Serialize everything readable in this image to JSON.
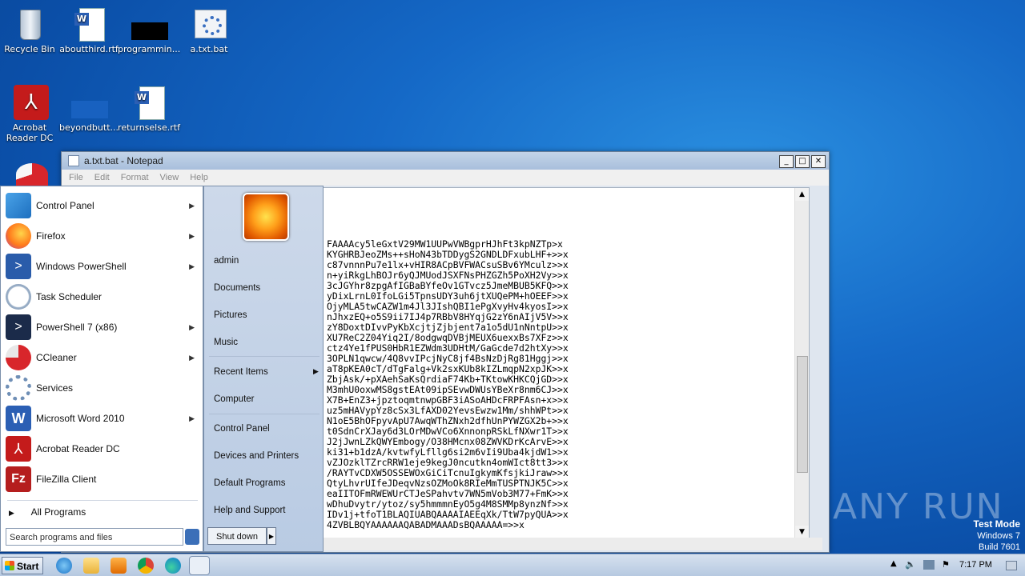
{
  "desktop": {
    "icons": [
      {
        "label": "Recycle Bin"
      },
      {
        "label": "aboutthird.rtf"
      },
      {
        "label": "programmin..."
      },
      {
        "label": "a.txt.bat"
      },
      {
        "label": "Acrobat Reader DC"
      },
      {
        "label": "beyondbutt..."
      },
      {
        "label": "returnselse.rtf"
      }
    ],
    "watermark": "ANY RUN",
    "testmode": {
      "line1": "Test Mode",
      "line2": "Windows 7",
      "line3": "Build 7601"
    }
  },
  "notepad": {
    "title": "a.txt.bat - Notepad",
    "menu": [
      "File",
      "Edit",
      "Format",
      "View",
      "Help"
    ],
    "controls": {
      "minimize": "_",
      "maximize": "□",
      "close": "✕"
    },
    "lines": [
      "FAAAAcy5leGxtV29MW1UUPwVWBgprHJhFt3kpNZTp>x",
      "KYGHRBJeoZMs++sHoN43bTDDygS2GNDLDFxubLHF+>>x",
      "c87vnnnPu7e1lx+vHIR8ACpBVFWACsuSBv6YMculz>>x",
      "n+yiRkgLhBOJr6yQJMUodJSXFNsPHZGZh5PoXH2Vy>>x",
      "3cJGYhr8zpgAfIGBaBYfeOv1GTvcz5JmeMBUB5KFQ>>x",
      "yDixLrnL0IfoLGi5TpnsUDY3uh6jtXUQePM+hOEEF>>x",
      "OjyMLA5twCAZW1m4Jl3JIshQBI1ePgXvyHv4kyosI>>x",
      "nJhxzEQ+o5S9ii7IJ4p7RBbV8HYqjG2zY6nAIjV5V>>x",
      "zY8DoxtDIvvPyKbXcjtjZjbjent7a1o5dU1nNntpU>>x",
      "XU7ReC2Z04Yiq2I/8odgwqDVBjMEUX6uexxBs7XFz>>x",
      "ctz4Ye1fPUS0HbR1EZWdm3UDHtM/GaGcde7d2htXy>>x",
      "3OPLN1qwcw/4Q8vvIPcjNyC8jf4BsNzDjRg81Hggj>>x",
      "aT8pKEA0cT/dTgFalg+Vk2sxKUb8kIZLmqpN2xpJK>>x",
      "ZbjAsk/+pXAehSaKsQrdiaF74Kb+TKtowKHKCQjGD>>x",
      "M3mhU0oxwMS8gstEAt09ipSEvwDWUsYBeXr8nm6CJ>>x",
      "X7B+EnZ3+jpztoqmtnwpGBF3iASoAHDcFRPFAsn+x>>x",
      "uz5mHAVypYz8cSx3LfAXD02YevsEwzw1Mm/shhWPt>>x",
      "N1oE5BhOFpyvApU7AwqWThZNxh2dfhUnPYWZGX2b+>>x",
      "t0SdnCrXJay6d3LOrMDwVCo6XnnonpRSkLfNXwr1T>>x",
      "J2jJwnLZkQWYEmbogy/O38HMcnx08ZWVKDrKcArvE>>x",
      "ki31+b1dzA/kvtwfyLfllg6si2m6vIi9Uba4kjdW1>>x",
      "vZJOzklTZrcRRW1eje9kegJ0ncutkn4omWIct8tt3>>x",
      "/RAYTvCDXW5OSSEWOxGiCiTcnuIgkymKfsjkiJraw>>x",
      "QtyLhvrUIfeJDeqvNzsOZMoOk8RIeMmTUSPTNJK5C>>x",
      "eaIITOFmRWEWUrCTJeSPahvtv7WN5mVob3M77+FmK>>x",
      "wDhuDvytr/ytoz/sy5hmmmnEyO5g4M8SMMp8ynzNf>>x",
      "IDv1j+tfoT1BLAQIUABQAAAAIAEEqXk/TtW7pyQUA>>x",
      "4ZVBLBQYAAAAAAQABADMAAADsBQAAAAA=>>x"
    ]
  },
  "start_menu": {
    "left_items": [
      {
        "label": "Control Panel",
        "arrow": true
      },
      {
        "label": "Firefox",
        "arrow": true
      },
      {
        "label": "Windows PowerShell",
        "arrow": true
      },
      {
        "label": "Task Scheduler",
        "arrow": false
      },
      {
        "label": "PowerShell 7 (x86)",
        "arrow": true
      },
      {
        "label": "CCleaner",
        "arrow": true
      },
      {
        "label": "Services",
        "arrow": false
      },
      {
        "label": "Microsoft Word 2010",
        "arrow": true
      },
      {
        "label": "Acrobat Reader DC",
        "arrow": false
      },
      {
        "label": "FileZilla Client",
        "arrow": false
      }
    ],
    "all_programs": "All Programs",
    "search_placeholder": "Search programs and files",
    "right_items": [
      {
        "label": "admin"
      },
      {
        "label": "Documents"
      },
      {
        "label": "Pictures"
      },
      {
        "label": "Music"
      },
      {
        "label": "Recent Items"
      },
      {
        "label": "Computer"
      },
      {
        "label": "Control Panel"
      },
      {
        "label": "Devices and Printers"
      },
      {
        "label": "Default Programs"
      },
      {
        "label": "Help and Support"
      }
    ],
    "shutdown": "Shut down"
  },
  "taskbar": {
    "start_label": "Start",
    "clock": "7:17 PM"
  }
}
